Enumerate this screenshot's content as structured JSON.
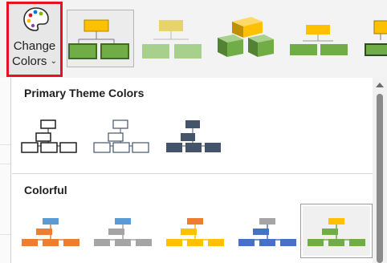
{
  "change_colors": {
    "line1": "Change",
    "line2": "Colors",
    "chevron": "⌄",
    "highlight_color": "#e81123"
  },
  "gallery": {
    "styles": [
      {
        "name": "current",
        "selected": true
      },
      {
        "name": "flat-green",
        "selected": false
      },
      {
        "name": "3d-cubes",
        "selected": false
      },
      {
        "name": "soft-green",
        "selected": false
      },
      {
        "name": "partial",
        "selected": false
      }
    ]
  },
  "dropdown": {
    "primary": {
      "heading": "Primary Theme Colors",
      "options": [
        {
          "name": "dark-1-outline",
          "box": "#ffffff",
          "stroke": "#1f1f1f"
        },
        {
          "name": "dark-2-outline",
          "box": "#ffffff",
          "stroke": "#44546a"
        },
        {
          "name": "dark-2-fill",
          "box": "#44546a",
          "stroke": "#44546a"
        }
      ]
    },
    "colorful": {
      "heading": "Colorful",
      "options": [
        {
          "name": "colorful-accent-colors",
          "top": "#5b9bd5",
          "bottom": "#ed7d31",
          "selected": false
        },
        {
          "name": "colorful-range-2-3",
          "top": "#5b9bd5",
          "bottom": "#a5a5a5",
          "selected": false
        },
        {
          "name": "colorful-range-3-4",
          "top": "#ed7d31",
          "bottom": "#ffc000",
          "selected": false
        },
        {
          "name": "colorful-range-4-5",
          "top": "#a5a5a5",
          "bottom": "#4472c4",
          "selected": false
        },
        {
          "name": "colorful-range-5-6",
          "top": "#ffc000",
          "bottom": "#70ad47",
          "selected": true
        }
      ]
    }
  },
  "scrollbar": {
    "up_icon": "triangle-up-icon"
  }
}
